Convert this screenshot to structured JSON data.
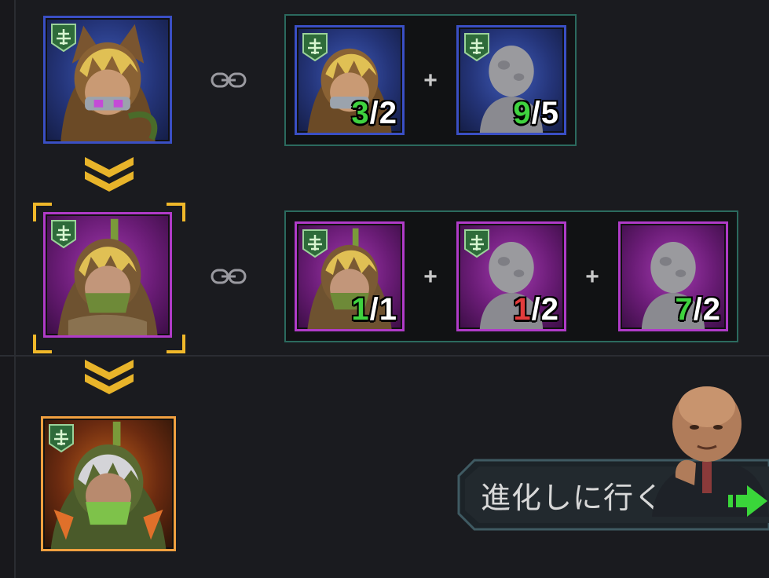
{
  "evolution": {
    "stages": [
      {
        "name": "stage-1",
        "rarity_color": "#3a4fc4",
        "materials": [
          {
            "name": "hero-copy",
            "current": "3",
            "required": "2",
            "status": "ok"
          },
          {
            "name": "generic",
            "current": "9",
            "required": "5",
            "status": "ok"
          }
        ]
      },
      {
        "name": "stage-2",
        "rarity_color": "#b03bc8",
        "selected": true,
        "materials": [
          {
            "name": "hero-copy",
            "current": "1",
            "required": "1",
            "status": "ok"
          },
          {
            "name": "generic-a",
            "current": "1",
            "required": "2",
            "status": "short"
          },
          {
            "name": "generic-b",
            "current": "7",
            "required": "2",
            "status": "ok"
          }
        ]
      },
      {
        "name": "stage-3",
        "rarity_color": "#f0a040"
      }
    ]
  },
  "counts": {
    "s1m1_cur": "3",
    "s1m1_sep": "/2",
    "s1m2_cur": "9",
    "s1m2_sep": "/5",
    "s2m1_cur": "1",
    "s2m1_sep": "/1",
    "s2m2_cur": "1",
    "s2m2_sep": "/2",
    "s2m3_cur": "7",
    "s2m3_sep": "/2"
  },
  "symbols": {
    "plus": "+"
  },
  "go_button": {
    "label": "進化しに行く"
  },
  "icons": [
    "class-badge-icon",
    "link-icon",
    "chevron-down-icon",
    "plus-icon",
    "go-arrow-icon",
    "silhouette-icon"
  ],
  "colors": {
    "count_ok": "#3fd23f",
    "count_short": "#e23c3c",
    "selection": "#f0b82a",
    "group_border": "#2b6a5e"
  }
}
